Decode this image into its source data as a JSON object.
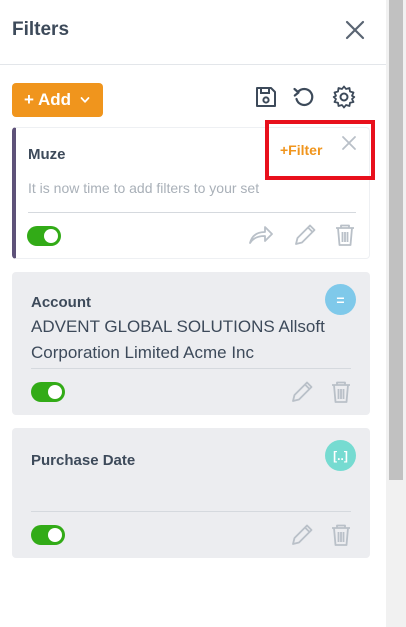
{
  "panel": {
    "title": "Filters"
  },
  "toolbar": {
    "add_label": "+ Add",
    "icons": [
      "chevron-down-icon",
      "save-icon",
      "reset-icon",
      "gear-icon"
    ]
  },
  "filter_sets": [
    {
      "name": "Muze",
      "placeholder": "It is now time to add filters to your set",
      "filter_link": "+Filter",
      "enabled": true,
      "accent": "#5e5279"
    }
  ],
  "filters": [
    {
      "name": "Account",
      "value": "ADVENT GLOBAL SOLUTIONS Allsoft Corporation Limited Acme Inc",
      "type_icon": "=",
      "type_color": "#7fc9ea",
      "enabled": true
    },
    {
      "name": "Purchase Date",
      "value": "",
      "type_icon": "[..]",
      "type_color": "#76dbd1",
      "enabled": true
    }
  ],
  "colors": {
    "accent_orange": "#f0951d",
    "toggle_green": "#32ab17",
    "highlight_red": "#e8101c",
    "text_dark": "#3d4a5a"
  }
}
